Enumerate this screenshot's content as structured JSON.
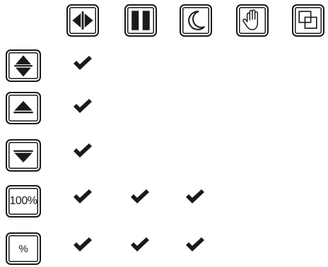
{
  "header_buttons": [
    {
      "icon": "resize-horizontal-icon"
    },
    {
      "icon": "pause-icon"
    },
    {
      "icon": "moon-icon"
    },
    {
      "icon": "hand-icon"
    },
    {
      "icon": "overlap-squares-icon"
    }
  ],
  "rows": [
    {
      "icon": "scroll-up-down-icon",
      "label": "",
      "checks": [
        true,
        false,
        false,
        false,
        false
      ]
    },
    {
      "icon": "arrow-up-icon",
      "label": "",
      "checks": [
        true,
        false,
        false,
        false,
        false
      ]
    },
    {
      "icon": "arrow-down-icon",
      "label": "",
      "checks": [
        true,
        false,
        false,
        false,
        false
      ]
    },
    {
      "icon": "",
      "label": "100%",
      "checks": [
        true,
        true,
        true,
        false,
        false
      ]
    },
    {
      "icon": "",
      "label": "%",
      "checks": [
        true,
        true,
        true,
        false,
        false
      ]
    }
  ],
  "check_icon": "check-mark-icon"
}
